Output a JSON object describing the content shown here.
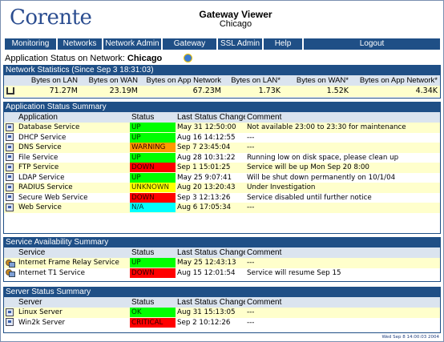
{
  "header": {
    "logo_text": "Corente",
    "title": "Gateway Viewer",
    "location": "Chicago"
  },
  "nav": {
    "items": [
      {
        "label": "Monitoring",
        "name": "nav-monitoring"
      },
      {
        "label": "Networks",
        "name": "nav-networks"
      },
      {
        "label": "Network Admin",
        "name": "nav-network-admin"
      },
      {
        "label": "Gateway Admin",
        "name": "nav-gateway-admin"
      },
      {
        "label": "SSL Admin",
        "name": "nav-ssl-admin"
      },
      {
        "label": "Help",
        "name": "nav-help"
      },
      {
        "label": "Logout",
        "name": "nav-logout"
      }
    ]
  },
  "status": {
    "prefix": "Application Status on Network:",
    "network": "Chicago"
  },
  "network_stats": {
    "title": "Network Statistics (Since Sep 3 18:31:03)",
    "headers": [
      "",
      "Bytes on LAN",
      "Bytes on WAN",
      "Bytes on App Network",
      "Bytes on LAN*",
      "Bytes on WAN*",
      "Bytes on App Network*"
    ],
    "values": [
      "",
      "71.27M",
      "23.19M",
      "67.23M",
      "1.73K",
      "1.52K",
      "4.34K"
    ]
  },
  "app_status": {
    "title": "Application Status Summary",
    "headers": {
      "app": "Application",
      "status": "Status",
      "change": "Last Status Change",
      "comment": "Comment"
    },
    "rows": [
      {
        "name": "Database Service",
        "status": "UP",
        "kind": "up",
        "change": "May 31 12:50:00",
        "comment": "Not available 23:00 to 23:30 for maintenance"
      },
      {
        "name": "DHCP Service",
        "status": "UP",
        "kind": "up",
        "change": "Aug 16 14:12:55",
        "comment": "---"
      },
      {
        "name": "DNS Service",
        "status": "WARNING",
        "kind": "warning",
        "change": "Sep 7 23:45:04",
        "comment": "---"
      },
      {
        "name": "File Service",
        "status": "UP",
        "kind": "up",
        "change": "Aug 28 10:31:22",
        "comment": "Running low on disk space, please clean up"
      },
      {
        "name": "FTP Service",
        "status": "DOWN",
        "kind": "down",
        "change": "Sep 1 15:01:25",
        "comment": "Service will be up Mon Sep 20 8:00"
      },
      {
        "name": "LDAP Service",
        "status": "UP",
        "kind": "up",
        "change": "May 25 9:07:41",
        "comment": "Will be shut down permanently on 10/1/04"
      },
      {
        "name": "RADIUS Service",
        "status": "UNKNOWN",
        "kind": "unknown",
        "change": "Aug 20 13:20:43",
        "comment": "Under Investigation"
      },
      {
        "name": "Secure Web Service",
        "status": "DOWN",
        "kind": "down",
        "change": "Sep 3 12:13:26",
        "comment": "Service disabled until further notice"
      },
      {
        "name": "Web Service",
        "status": "N/A",
        "kind": "na",
        "change": "Aug 6 17:05:34",
        "comment": "---"
      }
    ]
  },
  "service_availability": {
    "title": "Service Availability Summary",
    "headers": {
      "service": "Service",
      "status": "Status",
      "change": "Last Status Change",
      "comment": "Comment"
    },
    "rows": [
      {
        "name": "Internet Frame Relay Service",
        "status": "UP",
        "kind": "up",
        "change": "May 25 12:43:13",
        "comment": "---"
      },
      {
        "name": "Internet T1 Service",
        "status": "DOWN",
        "kind": "down",
        "change": "Aug 15 12:01:54",
        "comment": "Service will resume Sep 15"
      }
    ]
  },
  "server_status": {
    "title": "Server Status Summary",
    "headers": {
      "server": "Server",
      "status": "Status",
      "change": "Last Status Change",
      "comment": "Comment"
    },
    "rows": [
      {
        "name": "Linux Server",
        "status": "OK",
        "kind": "ok",
        "change": "Aug 31 15:13:05",
        "comment": "---"
      },
      {
        "name": "Win2k Server",
        "status": "CRITICAL",
        "kind": "critical",
        "change": "Sep 2 10:12:26",
        "comment": "---"
      }
    ]
  },
  "footer": {
    "timestamp": "Wed Sep 8 14:00:03 2004"
  },
  "colors": {
    "accent": "#1f4f86",
    "row_highlight": "#ffffcc",
    "up": "#00ff00",
    "warning": "#ff9900",
    "down": "#ff0000",
    "unknown": "#ffff00",
    "na": "#00ffff"
  },
  "icons": {
    "app_row": "application-icon",
    "service_row": "service-icon",
    "network_stats_row": "network-icon",
    "refresh": "refresh-icon"
  }
}
